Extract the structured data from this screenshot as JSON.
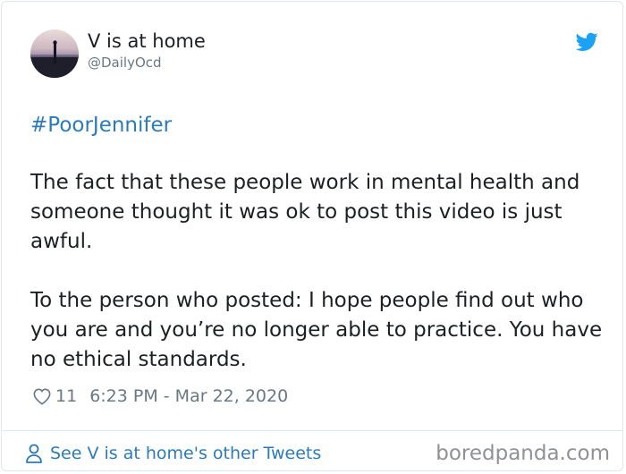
{
  "tweet": {
    "display_name": "V is at home",
    "handle": "@DailyOcd",
    "hashtag": "#PoorJennifer",
    "paragraphs": [
      "The fact that these people work in mental health and someone thought it was ok to post this video is just awful.",
      "To the person who posted: I hope people find out who you are and you’re no longer able to practice. You have no ethical standards."
    ],
    "likes": "11",
    "timestamp": "6:23 PM - Mar 22, 2020"
  },
  "footer": {
    "other_tweets_link": "See V is at home's other Tweets",
    "watermark": "boredpanda.com"
  },
  "icons": {
    "brand": "twitter-bird-icon",
    "like": "heart-icon",
    "profile": "person-icon"
  },
  "colors": {
    "link": "#2b7bb9",
    "twitter_blue": "#1da1f2",
    "muted": "#697882",
    "text": "#1c2022"
  }
}
